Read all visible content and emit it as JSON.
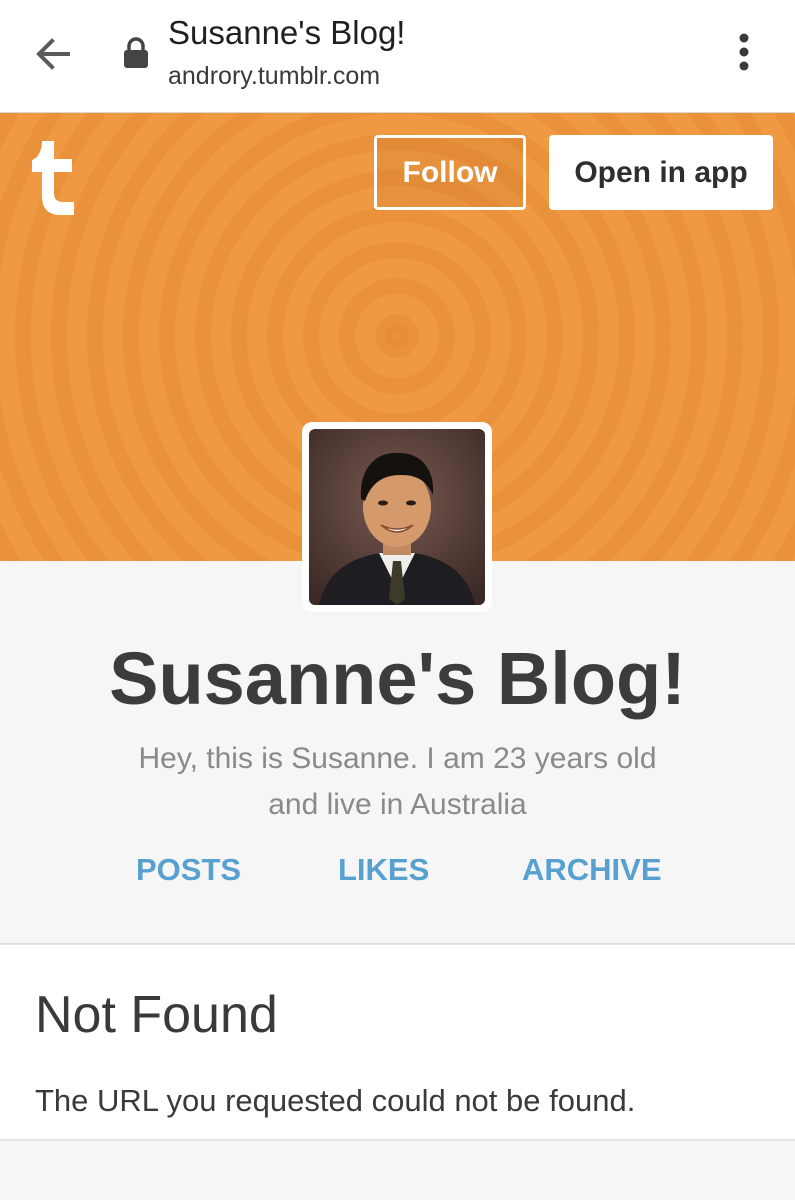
{
  "browser": {
    "title": "Susanne's Blog!",
    "url": "androry.tumblr.com",
    "back_icon": "arrow-left-icon",
    "lock_icon": "lock-icon",
    "menu_icon": "more-vertical-icon"
  },
  "header": {
    "logo_icon": "tumblr-logo-icon",
    "follow_label": "Follow",
    "open_app_label": "Open in app",
    "banner_color": "#ef9a43"
  },
  "blog": {
    "title": "Susanne's Blog!",
    "description": "Hey, this is Susanne. I am 23 years old and live in Australia",
    "nav": [
      "POSTS",
      "LIKES",
      "ARCHIVE"
    ]
  },
  "error": {
    "heading": "Not Found",
    "message": "The URL you requested could not be found."
  },
  "colors": {
    "accent_link": "#57a0d0",
    "title_text": "#3c3c3c"
  }
}
